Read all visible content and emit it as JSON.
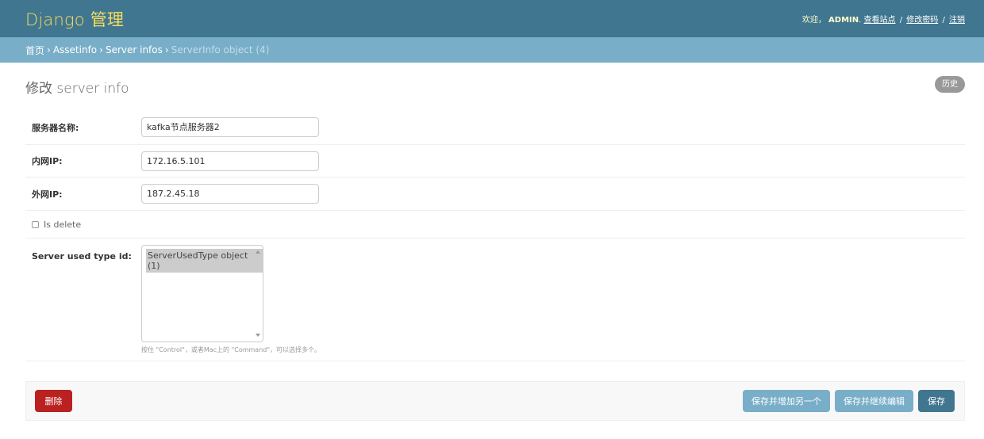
{
  "header": {
    "branding": "Django 管理",
    "welcome": "欢迎，",
    "username": "ADMIN",
    "view_site": "查看站点",
    "change_password": "修改密码",
    "logout": "注销"
  },
  "breadcrumbs": {
    "home": "首页",
    "app": "Assetinfo",
    "model": "Server infos",
    "current": "ServerInfo object (4)"
  },
  "page": {
    "title": "修改 server info",
    "history": "历史"
  },
  "form": {
    "server_name": {
      "label": "服务器名称:",
      "value": "kafka节点服务器2"
    },
    "inner_ip": {
      "label": "内网IP:",
      "value": "172.16.5.101"
    },
    "outer_ip": {
      "label": "外网IP:",
      "value": "187.2.45.18"
    },
    "is_delete": {
      "label": "Is delete",
      "checked": false
    },
    "server_used_type": {
      "label": "Server used type id:",
      "selected_option": "ServerUsedType object (1)",
      "help": "按住 \"Control\"，或者Mac上的 \"Command\"，可以选择多个。"
    }
  },
  "submit": {
    "delete": "删除",
    "save_add_another": "保存并增加另一个",
    "save_continue": "保存并继续编辑",
    "save": "保存"
  },
  "colors": {
    "header_bg": "#417690",
    "branding": "#f5dd5d",
    "breadcrumb_bg": "#79aec8",
    "delete": "#ba2121",
    "button": "#79aec8",
    "save": "#417690"
  }
}
